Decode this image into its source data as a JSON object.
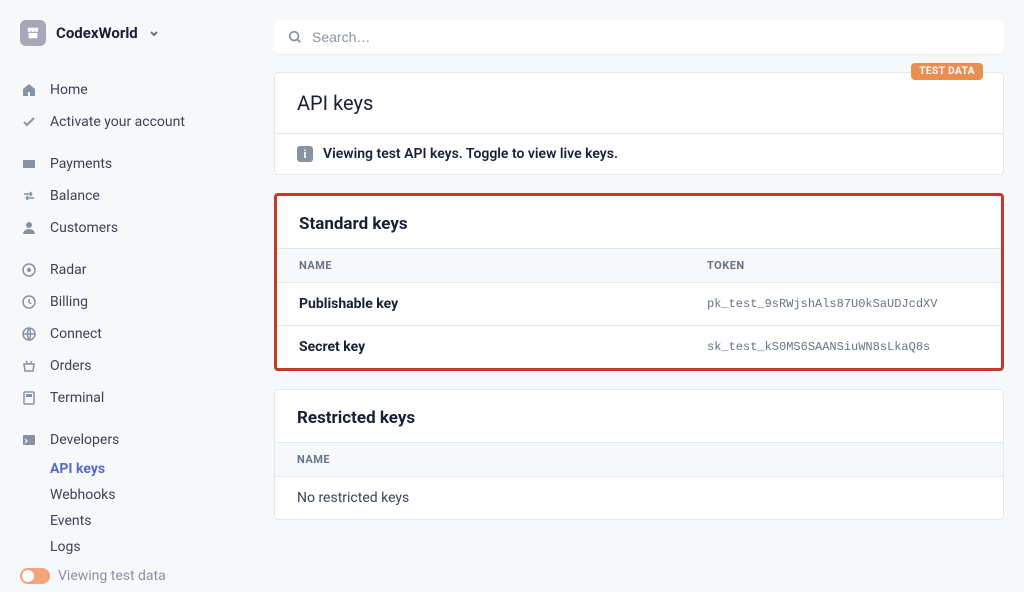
{
  "account": {
    "name": "CodexWorld"
  },
  "search": {
    "placeholder": "Search…"
  },
  "sidebar": {
    "groups": [
      {
        "items": [
          {
            "label": "Home"
          },
          {
            "label": "Activate your account"
          }
        ]
      },
      {
        "items": [
          {
            "label": "Payments"
          },
          {
            "label": "Balance"
          },
          {
            "label": "Customers"
          }
        ]
      },
      {
        "items": [
          {
            "label": "Radar"
          },
          {
            "label": "Billing"
          },
          {
            "label": "Connect"
          },
          {
            "label": "Orders"
          },
          {
            "label": "Terminal"
          }
        ]
      },
      {
        "items": [
          {
            "label": "Developers"
          }
        ],
        "sub": [
          {
            "label": "API keys"
          },
          {
            "label": "Webhooks"
          },
          {
            "label": "Events"
          },
          {
            "label": "Logs"
          }
        ]
      }
    ],
    "test_toggle_label": "Viewing test data"
  },
  "page": {
    "badge": "TEST DATA",
    "title": "API keys",
    "info": "Viewing test API keys. Toggle to view live keys."
  },
  "standard": {
    "heading": "Standard keys",
    "columns": {
      "name": "NAME",
      "token": "TOKEN"
    },
    "rows": [
      {
        "name": "Publishable key",
        "token": "pk_test_9sRWjshAls87U0kSaUDJcdXV"
      },
      {
        "name": "Secret key",
        "token": "sk_test_kS0MS6SAANSiuWN8sLkaQ8s"
      }
    ]
  },
  "restricted": {
    "heading": "Restricted keys",
    "columns": {
      "name": "NAME"
    },
    "empty": "No restricted keys"
  }
}
